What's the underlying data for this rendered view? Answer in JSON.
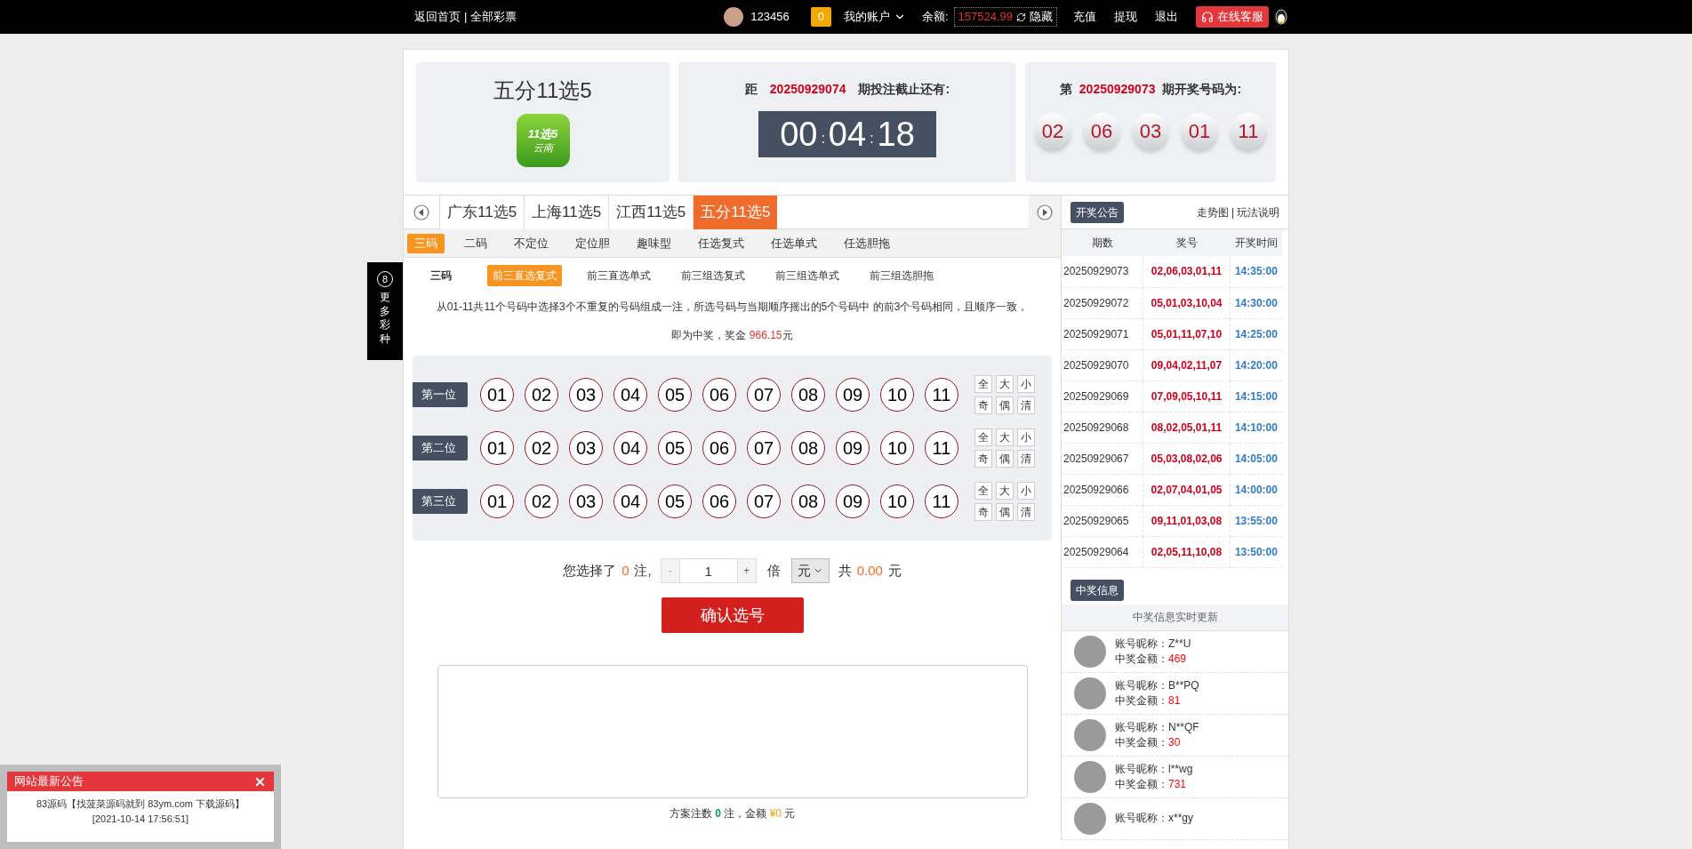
{
  "top_bar": {
    "links": [
      "返回首页",
      "全部彩票"
    ],
    "separator": "|",
    "user": "123456",
    "message_count": "0",
    "account_menu": "我的账户",
    "balance_label": "余额:",
    "balance": "157524.99",
    "hide_label": "隐藏",
    "actions": [
      "充值",
      "提现",
      "退出"
    ],
    "service": "在线客服"
  },
  "side_float": {
    "badge": "8",
    "label": "更多彩种"
  },
  "header": {
    "game_name": "五分11选5",
    "logo_text": [
      "11选5",
      "云南"
    ],
    "countdown": {
      "prefix": "距",
      "issue": "20250929074",
      "suffix": "期投注截止还有:",
      "time": [
        "00",
        "04",
        "18"
      ],
      "separator": ":"
    },
    "last_draw": {
      "prefix": "第",
      "issue": "20250929073",
      "suffix": "期开奖号码为:",
      "balls": [
        "02",
        "06",
        "03",
        "01",
        "11"
      ]
    }
  },
  "lottery_tabs": [
    {
      "label": "广东11选5",
      "selected": false
    },
    {
      "label": "上海11选5",
      "selected": false
    },
    {
      "label": "江西11选5",
      "selected": false
    },
    {
      "label": "五分11选5",
      "selected": true
    }
  ],
  "play_tabs": [
    {
      "label": "三码",
      "selected": true
    },
    {
      "label": "二码",
      "selected": false
    },
    {
      "label": "不定位",
      "selected": false
    },
    {
      "label": "定位胆",
      "selected": false
    },
    {
      "label": "趣味型",
      "selected": false
    },
    {
      "label": "任选复式",
      "selected": false
    },
    {
      "label": "任选单式",
      "selected": false
    },
    {
      "label": "任选胆拖",
      "selected": false
    }
  ],
  "sub_group_label": "三码",
  "sub_tabs": [
    {
      "label": "前三直选复式",
      "selected": true
    },
    {
      "label": "前三直选单式",
      "selected": false
    },
    {
      "label": "前三组选复式",
      "selected": false
    },
    {
      "label": "前三组选单式",
      "selected": false
    },
    {
      "label": "前三组选胆拖",
      "selected": false
    }
  ],
  "description": {
    "line1": "从01-11共11个号码中选择3个不重复的号码组成一注，所选号码与当期顺序摇出的5个号码中 的前3个号码相同，且顺序一致，",
    "prize_prefix": "即为中奖，奖金 ",
    "prize": "966.15",
    "prize_suffix": "元"
  },
  "positions": [
    {
      "label": "第一位",
      "numbers": [
        {
          "n": "01",
          "selected": false
        },
        {
          "n": "02",
          "selected": false
        },
        {
          "n": "03",
          "selected": false
        },
        {
          "n": "04",
          "selected": false
        },
        {
          "n": "05",
          "selected": false
        },
        {
          "n": "06",
          "selected": false
        },
        {
          "n": "07",
          "selected": false
        },
        {
          "n": "08",
          "selected": false
        },
        {
          "n": "09",
          "selected": false
        },
        {
          "n": "10",
          "selected": false
        },
        {
          "n": "11",
          "selected": false
        }
      ],
      "quick": [
        "全",
        "大",
        "小",
        "奇",
        "偶",
        "清"
      ]
    },
    {
      "label": "第二位",
      "numbers": [
        {
          "n": "01",
          "selected": false
        },
        {
          "n": "02",
          "selected": false
        },
        {
          "n": "03",
          "selected": false
        },
        {
          "n": "04",
          "selected": false
        },
        {
          "n": "05",
          "selected": false
        },
        {
          "n": "06",
          "selected": false
        },
        {
          "n": "07",
          "selected": false
        },
        {
          "n": "08",
          "selected": false
        },
        {
          "n": "09",
          "selected": false
        },
        {
          "n": "10",
          "selected": false
        },
        {
          "n": "11",
          "selected": false
        }
      ],
      "quick": [
        "全",
        "大",
        "小",
        "奇",
        "偶",
        "清"
      ]
    },
    {
      "label": "第三位",
      "numbers": [
        {
          "n": "01",
          "selected": false
        },
        {
          "n": "02",
          "selected": false
        },
        {
          "n": "03",
          "selected": false
        },
        {
          "n": "04",
          "selected": false
        },
        {
          "n": "05",
          "selected": false
        },
        {
          "n": "06",
          "selected": false
        },
        {
          "n": "07",
          "selected": false
        },
        {
          "n": "08",
          "selected": false
        },
        {
          "n": "09",
          "selected": false
        },
        {
          "n": "10",
          "selected": false
        },
        {
          "n": "11",
          "selected": false
        }
      ],
      "quick": [
        "全",
        "大",
        "小",
        "奇",
        "偶",
        "清"
      ]
    }
  ],
  "bet": {
    "label": "您选择了",
    "count": "0",
    "unit": "注,",
    "minus": "-",
    "multiplier": "1",
    "plus": "+",
    "times": "倍",
    "currency": "元",
    "total_prefix": "共",
    "total": "0.00",
    "total_unit": "元"
  },
  "confirm_button": "确认选号",
  "footer": {
    "label": "方案注数",
    "count": "0",
    "mid": "注，金额",
    "amount": "¥0",
    "unit": "元"
  },
  "right_panel": {
    "notice_button": "开奖公告",
    "links": [
      "走势图",
      "玩法说明"
    ],
    "separator": "|",
    "table": {
      "columns": [
        "期数",
        "奖号",
        "开奖时间"
      ],
      "rows": [
        [
          "20250929073",
          "02,06,03,01,11",
          "14:35:00"
        ],
        [
          "20250929072",
          "05,01,03,10,04",
          "14:30:00"
        ],
        [
          "20250929071",
          "05,01,11,07,10",
          "14:25:00"
        ],
        [
          "20250929070",
          "09,04,02,11,07",
          "14:20:00"
        ],
        [
          "20250929069",
          "07,09,05,10,11",
          "14:15:00"
        ],
        [
          "20250929068",
          "08,02,05,01,11",
          "14:10:00"
        ],
        [
          "20250929067",
          "05,03,08,02,06",
          "14:05:00"
        ],
        [
          "20250929066",
          "02,07,04,01,05",
          "14:00:00"
        ],
        [
          "20250929065",
          "09,11,01,03,08",
          "13:55:00"
        ],
        [
          "20250929064",
          "02,05,11,10,08",
          "13:50:00"
        ]
      ]
    },
    "winners_button": "中奖信息",
    "winners_title": "中奖信息实时更新",
    "winners": [
      {
        "name_label": "账号昵称：",
        "name": "Z**U",
        "amount_label": "中奖金额：",
        "amount": "469"
      },
      {
        "name_label": "账号昵称：",
        "name": "B**PQ",
        "amount_label": "中奖金额：",
        "amount": "81"
      },
      {
        "name_label": "账号昵称：",
        "name": "N**QF",
        "amount_label": "中奖金额：",
        "amount": "30"
      },
      {
        "name_label": "账号昵称：",
        "name": "l**wg",
        "amount_label": "中奖金额：",
        "amount": "731"
      },
      {
        "name_label": "账号昵称：",
        "name": "x**gy"
      }
    ]
  },
  "notice_popup": {
    "title": "网站最新公告",
    "message": "83源码【找菠菜源码就到 83ym.com 下载源码】",
    "time": "[2021-10-14 17:56:51]"
  }
}
